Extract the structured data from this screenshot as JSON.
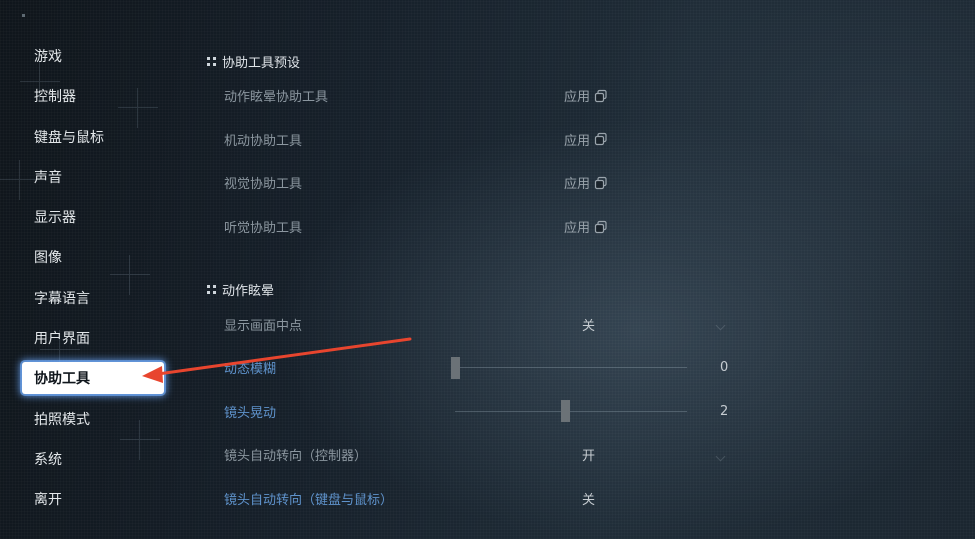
{
  "sidebar": {
    "items": [
      {
        "label": "游戏"
      },
      {
        "label": "控制器"
      },
      {
        "label": "键盘与鼠标"
      },
      {
        "label": "声音"
      },
      {
        "label": "显示器"
      },
      {
        "label": "图像"
      },
      {
        "label": "字幕语言"
      },
      {
        "label": "用户界面"
      },
      {
        "label": "协助工具",
        "active": true
      },
      {
        "label": "拍照模式"
      },
      {
        "label": "系统"
      },
      {
        "label": "离开"
      }
    ]
  },
  "presets": {
    "title": "协助工具预设",
    "apply_label": "应用",
    "rows": [
      {
        "label": "动作眩晕协助工具"
      },
      {
        "label": "机动协助工具"
      },
      {
        "label": "视觉协助工具"
      },
      {
        "label": "听觉协助工具"
      }
    ]
  },
  "motion": {
    "title": "动作眩晕",
    "rows": [
      {
        "label": "显示画面中点",
        "value": "关"
      },
      {
        "label": "动态模糊",
        "slider": 0,
        "value": "0"
      },
      {
        "label": "镜头晃动",
        "slider": 2,
        "value": "2"
      },
      {
        "label": "镜头自动转向（控制器）",
        "value": "开"
      },
      {
        "label": "镜头自动转向（键盘与鼠标）",
        "value": "关"
      }
    ]
  },
  "colors": {
    "accent_blue": "#5f93cc",
    "active_glow": "#6eaaff",
    "arrow_red": "#e8452e"
  },
  "icons": [
    "copy-icon",
    "chevron-down-icon",
    "drag-handle-icon"
  ]
}
